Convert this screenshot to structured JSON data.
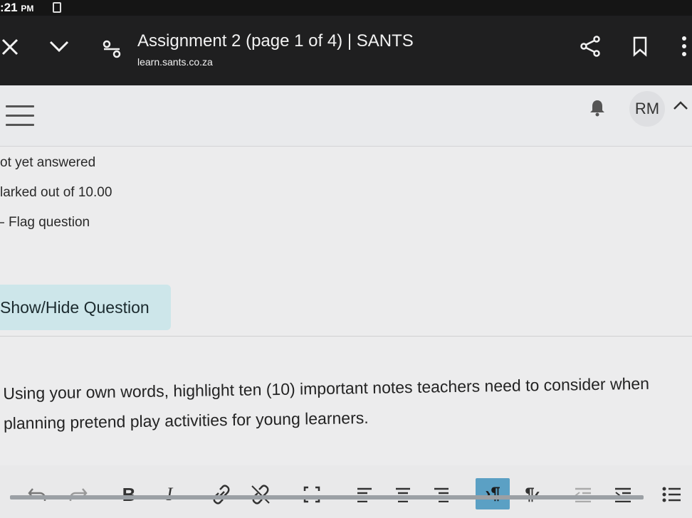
{
  "status_bar": {
    "time": ":21",
    "ampm": "PM"
  },
  "browser": {
    "title": "Assignment 2 (page 1 of 4) | SANTS",
    "url": "learn.sants.co.za",
    "icons": [
      "close-icon",
      "chevron-down-icon",
      "tabs-icon",
      "share-icon",
      "bookmark-icon",
      "more-vert-icon"
    ]
  },
  "header": {
    "avatar_initials": "RM",
    "icons": [
      "hamburger-menu-icon",
      "notification-bell-icon",
      "caret-up-icon"
    ]
  },
  "question_info": {
    "state": "ot yet answered",
    "marks": "larked out of 10.00",
    "flag_label": "Flag question"
  },
  "show_hide_label": "Show/Hide Question",
  "question_text_line1": "Using your own words, highlight ten (10) important notes teachers need to consider when",
  "question_text_line2": "planning pretend play activities for young learners.",
  "toolbar": {
    "bold_label": "B",
    "italic_label": "I",
    "ltr_label": "›¶",
    "rtl_label": "¶‹",
    "icons": [
      "undo-icon",
      "redo-icon",
      "link-icon",
      "unlink-icon",
      "fullscreen-icon",
      "align-left-icon",
      "align-center-icon",
      "align-right-icon",
      "ltr-icon",
      "rtl-icon",
      "outdent-icon",
      "indent-icon",
      "bullet-list-icon"
    ],
    "active_color": "#5ba0c4"
  },
  "colors": {
    "browser_bar": "#1f1f20",
    "page_background": "#ececed",
    "show_hide_background": "#cde6ea"
  }
}
